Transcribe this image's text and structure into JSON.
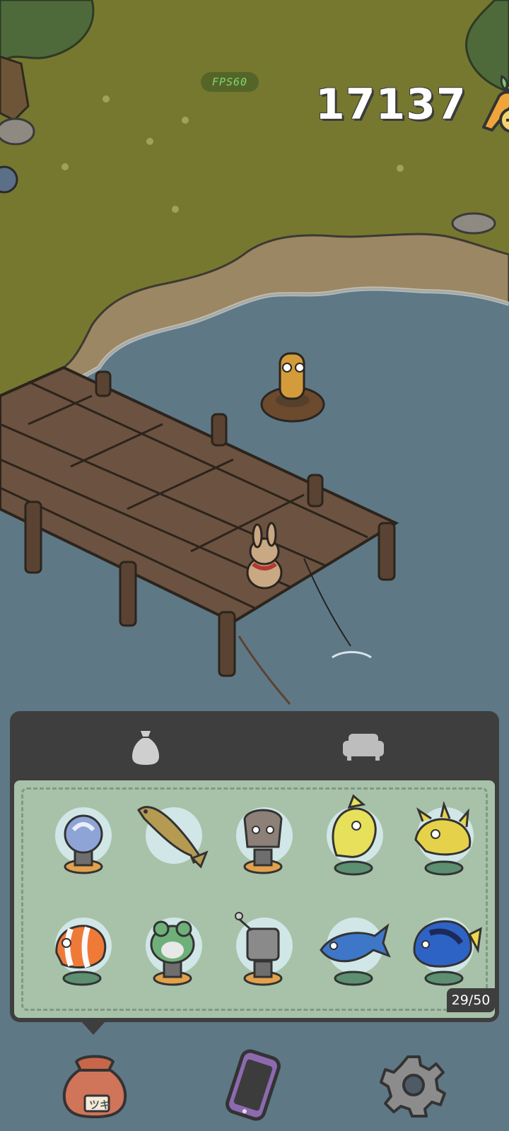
{
  "hud": {
    "fps_label": "FPS60",
    "carrot_count": "17137",
    "add_carrots_icon": "carrot-plus-icon"
  },
  "inventory": {
    "tabs": [
      {
        "name": "bag",
        "icon": "sack-icon",
        "active": true
      },
      {
        "name": "furniture",
        "icon": "sofa-icon",
        "active": false
      }
    ],
    "capacity": "29/50",
    "items": [
      {
        "icon": "blue-orb-trophy-icon"
      },
      {
        "icon": "brown-fish-icon"
      },
      {
        "icon": "fossil-trophy-icon"
      },
      {
        "icon": "yellow-fish-statue-icon"
      },
      {
        "icon": "yellow-spiky-fish-statue-icon"
      },
      {
        "icon": "clownfish-statue-icon"
      },
      {
        "icon": "frog-trophy-icon"
      },
      {
        "icon": "junk-trophy-icon"
      },
      {
        "icon": "blue-tuna-statue-icon"
      },
      {
        "icon": "blue-tang-statue-icon"
      }
    ]
  },
  "bottom_bar": [
    {
      "name": "bag",
      "icon": "bag-icon",
      "label": "ツキ"
    },
    {
      "name": "phone",
      "icon": "phone-icon"
    },
    {
      "name": "settings",
      "icon": "gear-icon"
    }
  ],
  "colors": {
    "grass": "#77782f",
    "water": "#5e7886",
    "panel_dark": "#3e3e3e",
    "panel_green": "#a8c2a9"
  }
}
